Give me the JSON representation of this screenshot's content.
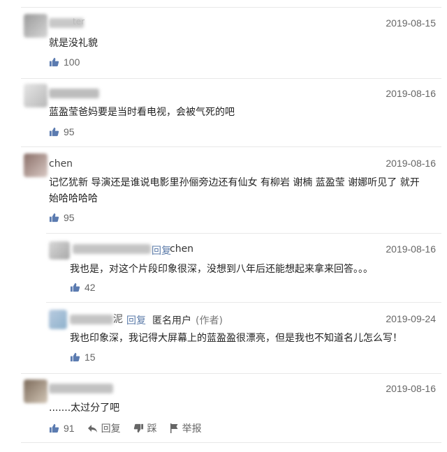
{
  "comments": [
    {
      "username_visible": "ter",
      "date": "2019-08-15",
      "text": "就是没礼貌",
      "likes": "100"
    },
    {
      "username_visible": "",
      "date": "2019-08-16",
      "text": "蓝盈莹爸妈要是当时看电视，会被气死的吧",
      "likes": "95"
    },
    {
      "username_visible": "chen",
      "date": "2019-08-16",
      "text_line1": "记忆犹新 导演还是谁说电影里孙俪旁边还有仙女 有柳岩 谢楠 蓝盈莹 谢娜听见了 就开",
      "text_line2": "始哈哈哈哈",
      "likes": "95"
    },
    {
      "reply_label": "回复",
      "reply_target": "chen",
      "date": "2019-08-16",
      "text": "我也是，对这个片段印象很深，没想到八年后还能想起来拿来回答。。。",
      "likes": "42"
    },
    {
      "name_suffix": "泥",
      "reply_label": "回复",
      "reply_target": "匿名用户",
      "author_tag": "(作者)",
      "date": "2019-09-24",
      "text": "我也印象深，我记得大屏幕上的蓝盈盈很漂亮，但是我也不知道名儿怎么写！",
      "likes": "15"
    },
    {
      "date": "2019-08-16",
      "text": ".......太过分了吧",
      "likes": "91",
      "actions": {
        "reply": "回复",
        "dislike": "踩",
        "report": "举报"
      }
    }
  ],
  "icons": {
    "like": "thumb-up-icon",
    "reply": "reply-arrow-icon",
    "dislike": "thumb-down-icon",
    "report": "flag-icon"
  },
  "colors": {
    "date": "#666666",
    "link": "#5a7aa8",
    "separator": "#e8e8e8"
  }
}
